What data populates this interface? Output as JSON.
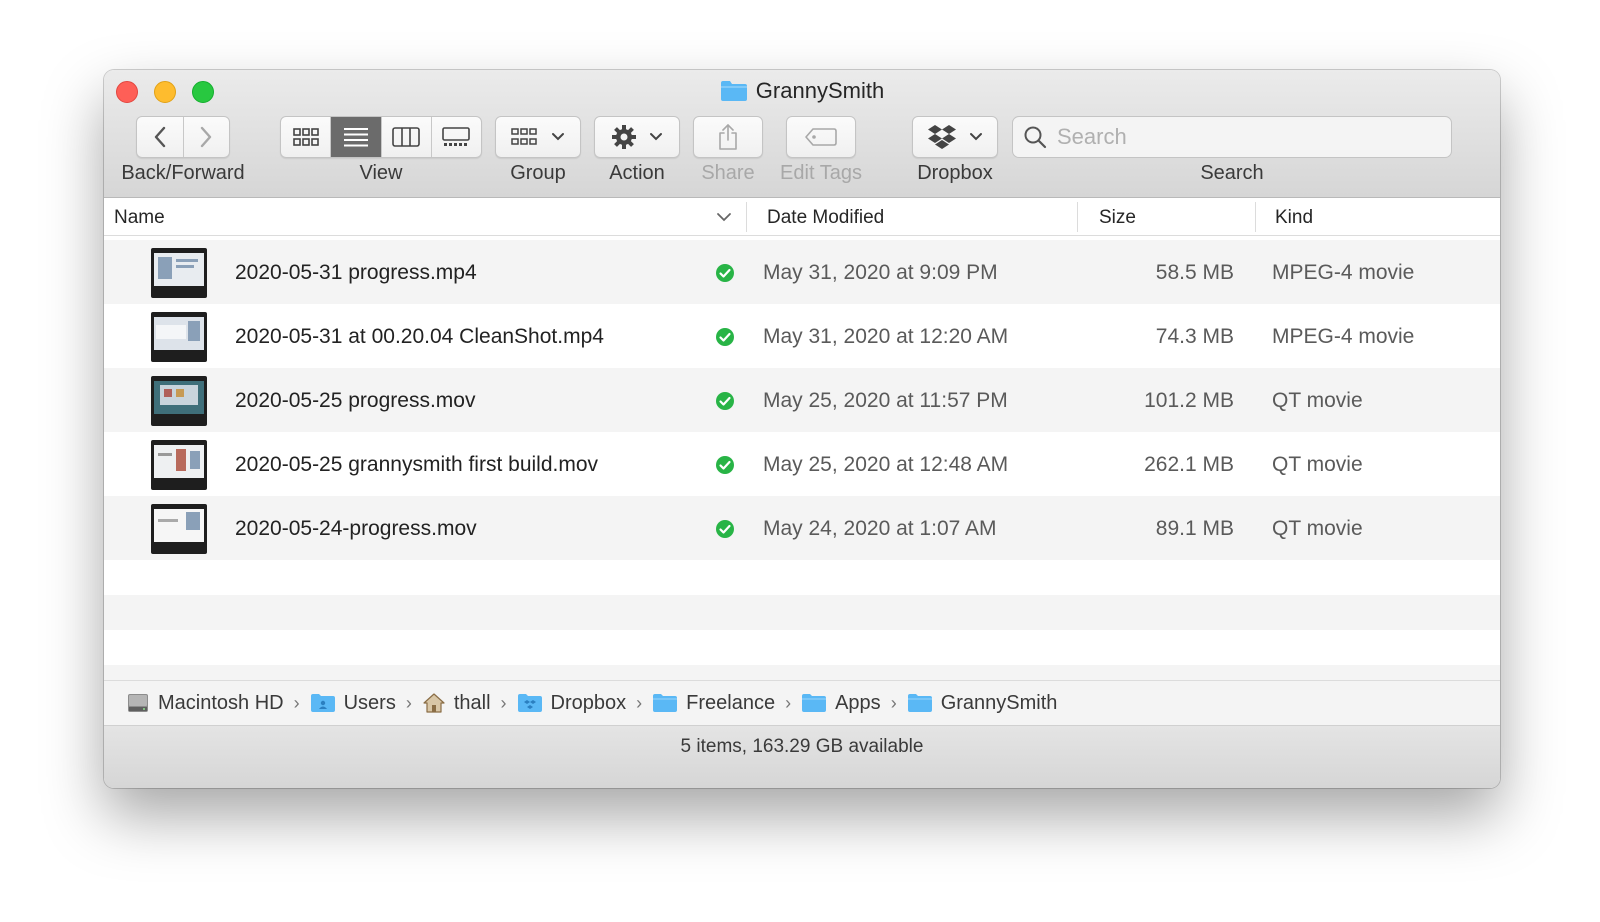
{
  "window": {
    "title": "GrannySmith"
  },
  "toolbar": {
    "back_forward_label": "Back/Forward",
    "view_label": "View",
    "group_label": "Group",
    "action_label": "Action",
    "share_label": "Share",
    "edit_tags_label": "Edit Tags",
    "dropbox_label": "Dropbox",
    "search_label": "Search",
    "search_placeholder": "Search",
    "active_view": "list"
  },
  "columns": {
    "name": "Name",
    "date_modified": "Date Modified",
    "size": "Size",
    "kind": "Kind"
  },
  "files": [
    {
      "name": "2020-05-31 progress.mp4",
      "date": "May 31, 2020 at 9:09 PM",
      "size": "58.5 MB",
      "kind": "MPEG-4 movie",
      "synced": true
    },
    {
      "name": "2020-05-31 at 00.20.04 CleanShot.mp4",
      "date": "May 31, 2020 at 12:20 AM",
      "size": "74.3 MB",
      "kind": "MPEG-4 movie",
      "synced": true
    },
    {
      "name": "2020-05-25 progress.mov",
      "date": "May 25, 2020 at 11:57 PM",
      "size": "101.2 MB",
      "kind": "QT movie",
      "synced": true
    },
    {
      "name": "2020-05-25 grannysmith first build.mov",
      "date": "May 25, 2020 at 12:48 AM",
      "size": "262.1 MB",
      "kind": "QT movie",
      "synced": true
    },
    {
      "name": "2020-05-24-progress.mov",
      "date": "May 24, 2020 at 1:07 AM",
      "size": "89.1 MB",
      "kind": "QT movie",
      "synced": true
    }
  ],
  "path": [
    {
      "label": "Macintosh HD",
      "icon": "hard-drive-icon"
    },
    {
      "label": "Users",
      "icon": "users-folder-icon"
    },
    {
      "label": "thall",
      "icon": "home-icon"
    },
    {
      "label": "Dropbox",
      "icon": "dropbox-folder-icon"
    },
    {
      "label": "Freelance",
      "icon": "folder-icon"
    },
    {
      "label": "Apps",
      "icon": "folder-icon"
    },
    {
      "label": "GrannySmith",
      "icon": "folder-icon"
    }
  ],
  "status": {
    "text": "5 items, 163.29 GB available"
  },
  "colors": {
    "folder": "#5ab8f5",
    "sync_check": "#28b446",
    "active_segment": "#6b6b6b"
  }
}
